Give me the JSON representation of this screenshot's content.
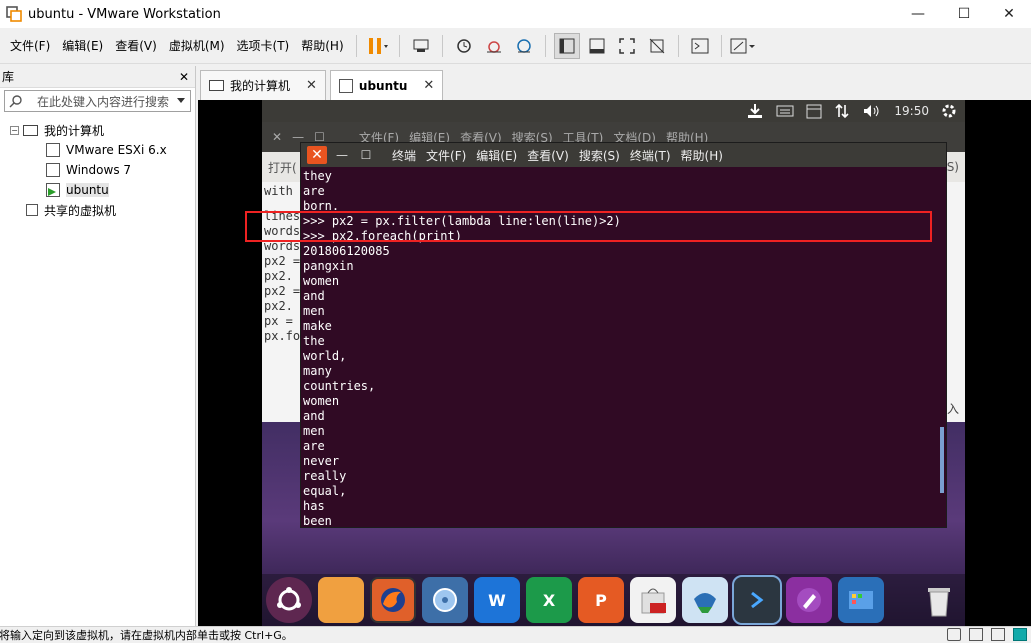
{
  "window": {
    "title": "ubuntu - VMware Workstation",
    "minimize": "—",
    "maximize": "☐",
    "close": "✕"
  },
  "menu": {
    "items": [
      "文件(F)",
      "编辑(E)",
      "查看(V)",
      "虚拟机(M)",
      "选项卡(T)",
      "帮助(H)"
    ]
  },
  "library": {
    "title": "库",
    "close": "✕",
    "search_placeholder": "在此处键入内容进行搜索",
    "tree": {
      "root": "我的计算机",
      "vms": [
        "VMware ESXi 6.x",
        "Windows 7",
        "ubuntu"
      ],
      "shared": "共享的虚拟机"
    }
  },
  "tabs": [
    {
      "label": "我的计算机",
      "close": "✕"
    },
    {
      "label": "ubuntu",
      "close": "✕"
    }
  ],
  "ubuntu": {
    "topbar": {
      "time": "19:50"
    },
    "bg_window": {
      "menu": [
        "文件(F)",
        "编辑(E)",
        "查看(V)",
        "搜索(S)",
        "工具(T)",
        "文档(D)",
        "帮助(H)"
      ],
      "toolbar_text": "打开(",
      "toolbar_right": "S)",
      "lines": [
        "with",
        "lines",
        "words",
        "words",
        "px2 =",
        "px2.",
        "px2 =",
        "px2.",
        "px =",
        "px.fo"
      ],
      "bottom_right": "入"
    },
    "terminal": {
      "menu": [
        "终端",
        "文件(F)",
        "编辑(E)",
        "查看(V)",
        "搜索(S)",
        "终端(T)",
        "帮助(H)"
      ],
      "lines": [
        "they",
        "are",
        "born.",
        ">>> px2 = px.filter(lambda line:len(line)>2)",
        ">>> px2.foreach(print)",
        "201806120085",
        "pangxin",
        "women",
        "and",
        "men",
        "make",
        "the",
        "world,",
        "many",
        "countries,",
        "women",
        "and",
        "men",
        "are",
        "never",
        "really",
        "equal,",
        "has",
        "been"
      ]
    },
    "dock": {
      "icons": [
        "ubuntu-icon",
        "files-icon",
        "firefox-icon",
        "disk-icon",
        "writer-icon",
        "calc-icon",
        "impress-icon",
        "software-icon",
        "remmina-icon",
        "terminal-icon",
        "editor-icon",
        "apps-icon",
        "trash-icon"
      ]
    }
  },
  "status": {
    "text": "要将输入定向到该虚拟机，请在虚拟机内部单击或按 Ctrl+G。"
  },
  "colors": {
    "terminal_bg": "#300a24",
    "ubuntu_orange": "#e95420",
    "highlight": "#ee2222"
  }
}
